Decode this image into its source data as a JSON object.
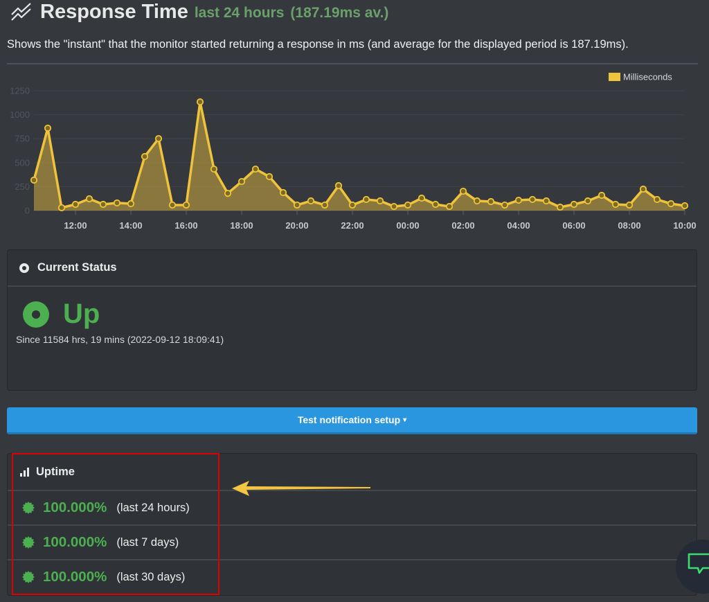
{
  "header": {
    "icon": "line-chart-icon",
    "title": "Response Time",
    "subtitle": "last 24 hours",
    "average": "(187.19ms av.)",
    "description": "Shows the \"instant\" that the monitor started returning a response in ms (and average for the displayed period is 187.19ms)."
  },
  "colors": {
    "series": "#f0c33c",
    "up_green": "#4caf50",
    "button_blue": "#2a96e0",
    "highlight_red": "#e00000"
  },
  "chart_data": {
    "type": "area",
    "title": "Response Time",
    "xlabel": "",
    "ylabel": "",
    "legend": [
      {
        "name": "Milliseconds",
        "color": "#f0c33c"
      }
    ],
    "legend_position": "top-right",
    "ylim": [
      0,
      1250
    ],
    "yticks": [
      "0",
      "250",
      "500",
      "750",
      "1000",
      "1250"
    ],
    "xticks": [
      "12:00",
      "14:00",
      "16:00",
      "18:00",
      "20:00",
      "22:00",
      "00:00",
      "02:00",
      "04:00",
      "06:00",
      "08:00",
      "10:00"
    ],
    "x_start_hour": 10.5,
    "x_step_hours": 0.5,
    "grid": true,
    "series": [
      {
        "name": "Milliseconds",
        "values": [
          318,
          860,
          30,
          65,
          123,
          65,
          80,
          72,
          564,
          751,
          58,
          58,
          1134,
          433,
          180,
          303,
          433,
          354,
          188,
          58,
          101,
          58,
          260,
          58,
          116,
          101,
          43,
          58,
          130,
          65,
          43,
          202,
          101,
          94,
          58,
          108,
          116,
          101,
          36,
          65,
          101,
          159,
          65,
          58,
          224,
          116,
          72,
          51
        ]
      }
    ]
  },
  "current_status": {
    "heading": "Current Status",
    "state": "Up",
    "since": "Since 11584 hrs, 19 mins (2022-09-12 18:09:41)"
  },
  "test_button": {
    "label": "Test notification setup",
    "caret": "▾"
  },
  "uptime": {
    "heading": "Uptime",
    "items": [
      {
        "percent": "100.000%",
        "period": "(last 24 hours)"
      },
      {
        "percent": "100.000%",
        "period": "(last 7 days)"
      },
      {
        "percent": "100.000%",
        "period": "(last 30 days)"
      }
    ]
  }
}
